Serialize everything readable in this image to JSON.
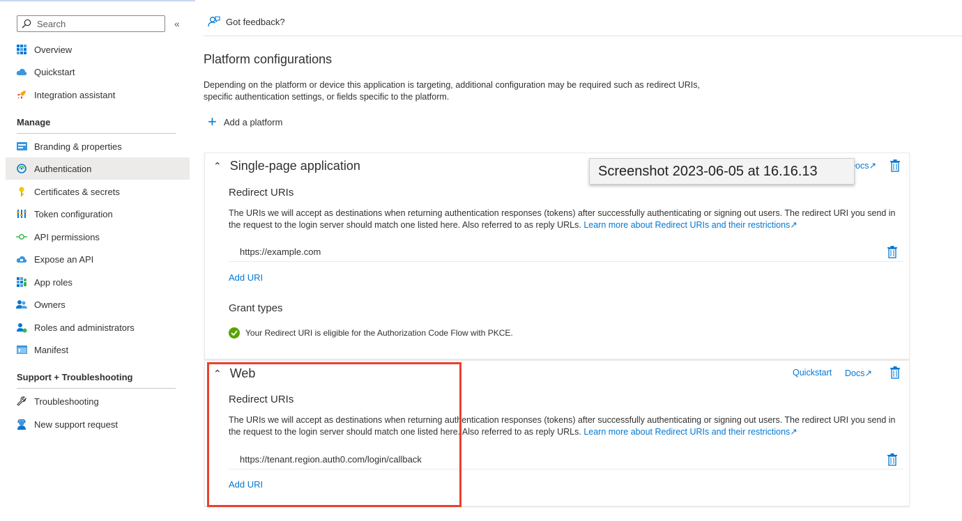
{
  "search": {
    "placeholder": "Search"
  },
  "sidebar": {
    "items_top": [
      {
        "label": "Overview",
        "icon": "grid-icon"
      },
      {
        "label": "Quickstart",
        "icon": "cloud-icon"
      },
      {
        "label": "Integration assistant",
        "icon": "rocket-icon"
      }
    ],
    "manage_title": "Manage",
    "manage_items": [
      {
        "label": "Branding & properties",
        "icon": "branding-icon"
      },
      {
        "label": "Authentication",
        "icon": "authentication-icon",
        "active": true
      },
      {
        "label": "Certificates & secrets",
        "icon": "key-icon"
      },
      {
        "label": "Token configuration",
        "icon": "token-icon"
      },
      {
        "label": "API permissions",
        "icon": "api-permissions-icon"
      },
      {
        "label": "Expose an API",
        "icon": "cloud-api-icon"
      },
      {
        "label": "App roles",
        "icon": "app-roles-icon"
      },
      {
        "label": "Owners",
        "icon": "owners-icon"
      },
      {
        "label": "Roles and administrators",
        "icon": "roles-icon"
      },
      {
        "label": "Manifest",
        "icon": "manifest-icon"
      }
    ],
    "support_title": "Support + Troubleshooting",
    "support_items": [
      {
        "label": "Troubleshooting",
        "icon": "wrench-icon"
      },
      {
        "label": "New support request",
        "icon": "support-person-icon"
      }
    ]
  },
  "toolbar": {
    "feedback": "Got feedback?"
  },
  "main": {
    "title": "Platform configurations",
    "description": "Depending on the platform or device this application is targeting, additional configuration may be required such as redirect URIs, specific authentication settings, or fields specific to the platform.",
    "add_platform": "Add a platform",
    "spa": {
      "title": "Single-page application",
      "docs": "Docs",
      "redirect_title": "Redirect URIs",
      "redirect_text": "The URIs we will accept as destinations when returning authentication responses (tokens) after successfully authenticating or signing out users. The redirect URI you send in the request to the login server should match one listed here. Also referred to as reply URLs.",
      "learn_more": "Learn more about Redirect URIs and their restrictions",
      "uri": "https://example.com",
      "add_uri": "Add URI",
      "grant_title": "Grant types",
      "grant_text": "Your Redirect URI is eligible for the Authorization Code Flow with PKCE."
    },
    "web": {
      "title": "Web",
      "quickstart": "Quickstart",
      "docs": "Docs",
      "redirect_title": "Redirect URIs",
      "redirect_text": "The URIs we will accept as destinations when returning authentication responses (tokens) after successfully authenticating or signing out users. The redirect URI you send in the request to the login server should match one listed here. Also referred to as reply URLs.",
      "learn_more": "Learn more about Redirect URIs and their restrictions",
      "uri": "https://tenant.region.auth0.com/login/callback",
      "add_uri": "Add URI"
    }
  },
  "tooltip": "Screenshot 2023-06-05 at 16.16.13",
  "colors": {
    "accent": "#0078d4",
    "highlight_box": "#e8412e",
    "success": "#57a300"
  }
}
